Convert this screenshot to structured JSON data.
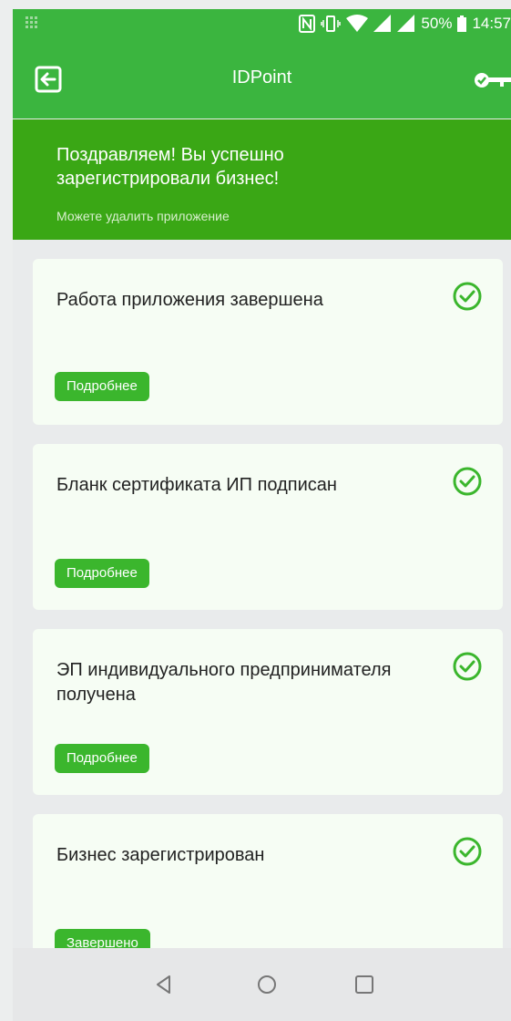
{
  "status_bar": {
    "battery": "50%",
    "time": "14:57"
  },
  "app_bar": {
    "title": "IDPoint"
  },
  "banner": {
    "title": "Поздравляем! Вы успешно зарегистрировали бизнес!",
    "subtitle": "Можете удалить приложение"
  },
  "cards": [
    {
      "title": "Работа приложения завершена",
      "button": "Подробнее"
    },
    {
      "title": "Бланк сертификата ИП подписан",
      "button": "Подробнее"
    },
    {
      "title": "ЭП индивидуального предпринимателя получена",
      "button": "Подробнее"
    },
    {
      "title": "Бизнес зарегистрирован",
      "button": "Завершено"
    }
  ],
  "colors": {
    "primary": "#3bb53f",
    "banner": "#3aa715",
    "button": "#3bb62d",
    "card_bg": "#f6fdf4"
  }
}
